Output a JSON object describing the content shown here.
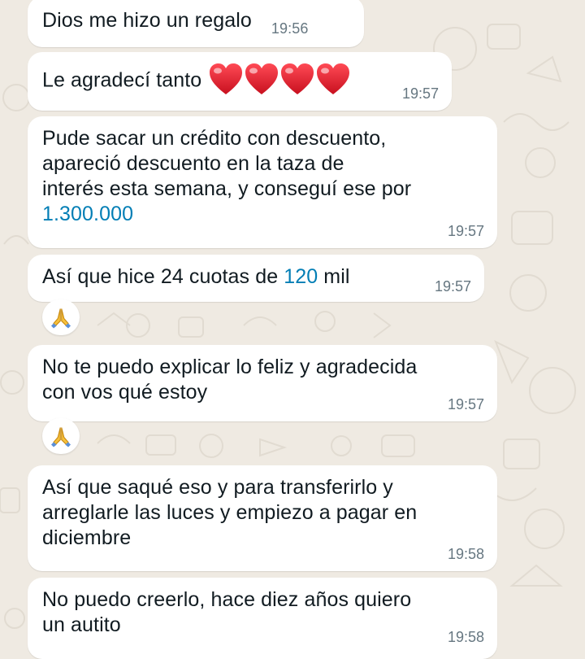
{
  "theme": {
    "bubble": "#ffffff",
    "wallpaper": "#efeae2",
    "link": "#027eb5",
    "time": "#667781",
    "heart": "#e8152a"
  },
  "messages": [
    {
      "text": "Dios me hizo un regalo",
      "time": "19:56"
    },
    {
      "text": "Le agradecí tanto",
      "emoji": [
        "heart-icon",
        "heart-icon",
        "heart-icon",
        "heart-icon"
      ],
      "time": "19:57"
    },
    {
      "lines": [
        "Pude sacar un crédito con descuento,",
        "apareció descuento en la taza de",
        "interés esta semana, y conseguí ese por"
      ],
      "amount": "1.300.000",
      "time": "19:57"
    },
    {
      "before": "Así que hice 24 cuotas de ",
      "number": "120",
      "after": " mil",
      "time": "19:57",
      "reaction": "praying-hands-icon"
    },
    {
      "lines": [
        "No te puedo explicar lo feliz y agradecida",
        "con vos qué estoy"
      ],
      "time": "19:57",
      "reaction": "praying-hands-icon"
    },
    {
      "lines": [
        "Así que saqué eso y para transferirlo y",
        "arreglarle las luces y empiezo a pagar en",
        "diciembre"
      ],
      "time": "19:58"
    },
    {
      "lines": [
        "No puedo creerlo, hace diez años quiero",
        "un autito"
      ],
      "time": "19:58"
    }
  ]
}
